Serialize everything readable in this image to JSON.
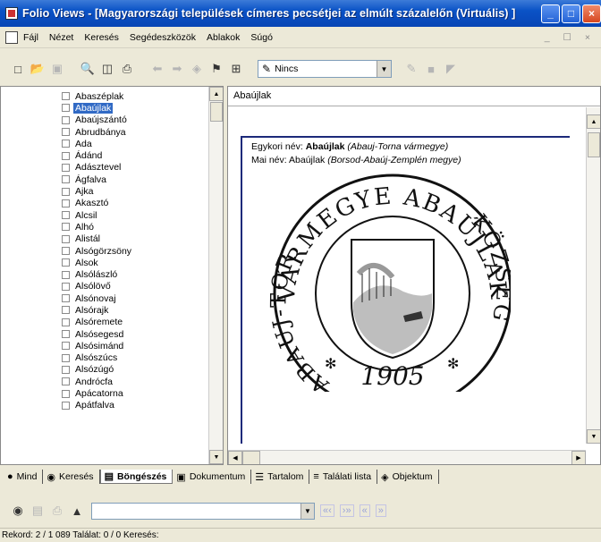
{
  "window": {
    "title": "Folio Views - [Magyarországi települések címeres pecsétjei az elmúlt százalelőn (Virtuális) ]",
    "min_label": "_",
    "max_label": "□",
    "close_label": "×"
  },
  "menu": {
    "items": [
      "Fájl",
      "Nézet",
      "Keresés",
      "Segédeszközök",
      "Ablakok",
      "Súgó"
    ],
    "mdi_controls": "_ ☐ ×"
  },
  "toolbar": {
    "combo_value": "Nincs"
  },
  "list": {
    "items": [
      "Abaszéplak",
      "Abaújlak",
      "Abaújszántó",
      "Abrudbánya",
      "Ada",
      "Ádánd",
      "Adásztevel",
      "Ágfalva",
      "Ajka",
      "Akasztó",
      "Alcsil",
      "Alhó",
      "Alistál",
      "Alsógörzsöny",
      "Alsok",
      "Alsólászló",
      "Alsólövő",
      "Alsónovaj",
      "Alsórajk",
      "Alsóremete",
      "Alsósegesd",
      "Alsósimánd",
      "Alsószúcs",
      "Alsózúgó",
      "Andrócfa",
      "Apácatorna",
      "Apátfalva"
    ],
    "selected_index": 1
  },
  "document": {
    "tab_title": "Abaújlak",
    "line1_prefix": "Egykori név: ",
    "line1_name": "Abaújlak",
    "line1_county": "(Abauj-Torna vármegye)",
    "line2_prefix": "Mai név: Abaújlak ",
    "line2_county": "(Borsod-Abaúj-Zemplén megye)",
    "seal": {
      "top_text": "VÁRMEGYE ABAÚJLAK",
      "right_text": "KÖZSÉG",
      "left_text": "ABAUJ-TORNA",
      "year": "1905",
      "star": "✻"
    }
  },
  "tabs": [
    {
      "label": "Mind",
      "icon": "globe-icon"
    },
    {
      "label": "Keresés",
      "icon": "binoculars-icon"
    },
    {
      "label": "Böngészés",
      "icon": "book-icon",
      "active": true
    },
    {
      "label": "Dokumentum",
      "icon": "document-icon"
    },
    {
      "label": "Tartalom",
      "icon": "contents-icon"
    },
    {
      "label": "Találati lista",
      "icon": "list-icon"
    },
    {
      "label": "Objektum",
      "icon": "object-icon"
    }
  ],
  "status": {
    "text": "Rekord: 2 / 1 089   Találat: 0 / 0   Keresés:"
  }
}
